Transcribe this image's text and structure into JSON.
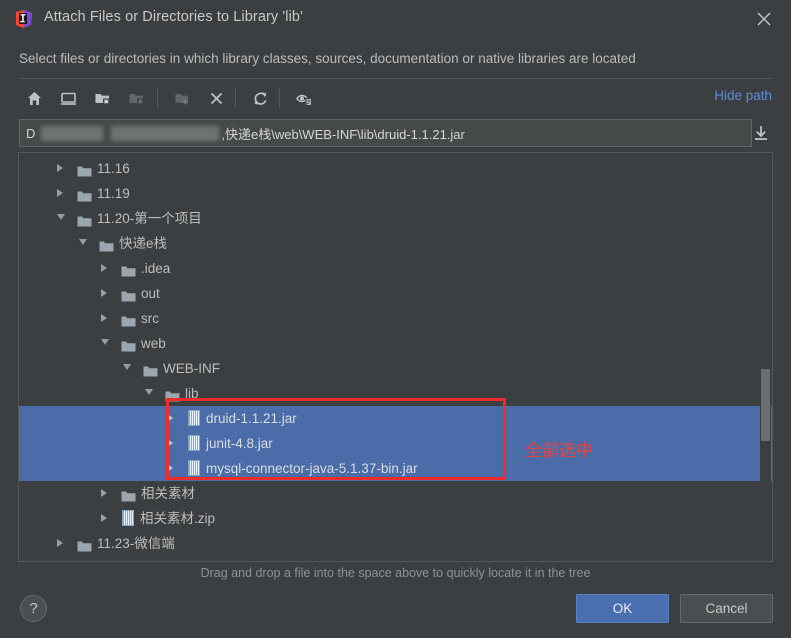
{
  "window": {
    "title": "Attach Files or Directories to Library 'lib'",
    "app_icon": "intellij-idea-logo",
    "close_icon": "close-icon"
  },
  "subtitle": "Select files or directories in which library classes, sources, documentation or native libraries are located",
  "toolbar": {
    "hide_path_label": "Hide path",
    "buttons": [
      {
        "name": "home-icon",
        "tooltip": "Home",
        "disabled": false
      },
      {
        "name": "desktop-icon",
        "tooltip": "Desktop",
        "disabled": false
      },
      {
        "name": "project-folder-icon",
        "tooltip": "Project",
        "disabled": false
      },
      {
        "name": "module-folder-icon",
        "tooltip": "Module",
        "disabled": true
      },
      {
        "name": "new-folder-icon",
        "tooltip": "New Folder",
        "disabled": true
      },
      {
        "name": "delete-icon",
        "tooltip": "Delete",
        "disabled": false
      },
      {
        "name": "refresh-icon",
        "tooltip": "Refresh",
        "disabled": false
      },
      {
        "name": "show-hidden-files-icon",
        "tooltip": "Show Hidden Files",
        "disabled": false
      }
    ]
  },
  "path": {
    "prefix": "D",
    "redacted": true,
    "visible_tail": ",快递e栈\\web\\WEB-INF\\lib\\druid-1.1.21.jar",
    "download_icon": "download-icon"
  },
  "tree": {
    "rows": [
      {
        "label": "11.16",
        "indent": 0,
        "arrow": "closed",
        "icon": "folder",
        "selected": false
      },
      {
        "label": "11.19",
        "indent": 0,
        "arrow": "closed",
        "icon": "folder",
        "selected": false
      },
      {
        "label": "11.20-第一个项目",
        "indent": 0,
        "arrow": "open",
        "icon": "folder",
        "selected": false
      },
      {
        "label": "快递e栈",
        "indent": 1,
        "arrow": "open",
        "icon": "folder",
        "selected": false
      },
      {
        "label": ".idea",
        "indent": 2,
        "arrow": "closed",
        "icon": "folder",
        "selected": false
      },
      {
        "label": "out",
        "indent": 2,
        "arrow": "closed",
        "icon": "folder",
        "selected": false
      },
      {
        "label": "src",
        "indent": 2,
        "arrow": "closed",
        "icon": "folder",
        "selected": false
      },
      {
        "label": "web",
        "indent": 2,
        "arrow": "open",
        "icon": "folder",
        "selected": false
      },
      {
        "label": "WEB-INF",
        "indent": 3,
        "arrow": "open",
        "icon": "folder",
        "selected": false
      },
      {
        "label": "lib",
        "indent": 4,
        "arrow": "open",
        "icon": "folder",
        "selected": false
      },
      {
        "label": "druid-1.1.21.jar",
        "indent": 5,
        "arrow": "closed",
        "icon": "jar",
        "selected": true
      },
      {
        "label": "junit-4.8.jar",
        "indent": 5,
        "arrow": "closed",
        "icon": "jar",
        "selected": true
      },
      {
        "label": "mysql-connector-java-5.1.37-bin.jar",
        "indent": 5,
        "arrow": "closed",
        "icon": "jar",
        "selected": true
      },
      {
        "label": "相关素材",
        "indent": 2,
        "arrow": "closed",
        "icon": "folder",
        "selected": false
      },
      {
        "label": "相关素材.zip",
        "indent": 2,
        "arrow": "closed",
        "icon": "jar",
        "selected": false
      },
      {
        "label": "11.23-微信端",
        "indent": 0,
        "arrow": "closed",
        "icon": "folder",
        "selected": false
      }
    ]
  },
  "annotation": {
    "note": "全部选中",
    "color": "#e8433f"
  },
  "footer": {
    "hint": "Drag and drop a file into the space above to quickly locate it in the tree",
    "help_label": "?",
    "ok_label": "OK",
    "cancel_label": "Cancel"
  },
  "colors": {
    "background": "#3c3f41",
    "selection": "#4a6ca8",
    "link": "#5a8cd6",
    "annotation": "#e8433f",
    "primary_button": "#4a6fb0"
  }
}
